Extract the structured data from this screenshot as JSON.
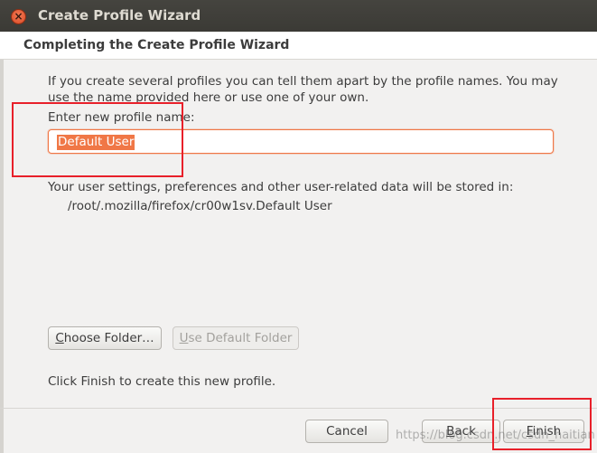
{
  "window": {
    "title": "Create Profile Wizard",
    "close_glyph": "×"
  },
  "page": {
    "heading": "Completing the Create Profile Wizard",
    "description": "If you create several profiles you can tell them apart by the profile names. You may use the name provided here or use one of your own.",
    "name_prompt": "Enter new profile name:",
    "profile_name_value": "Default User",
    "storage_label": "Your user settings, preferences and other user-related data will be stored in:",
    "storage_path": "/root/.mozilla/firefox/cr00w1sv.Default User",
    "choose_folder_label_first": "C",
    "choose_folder_label_rest": "hoose Folder…",
    "use_default_label_first": "U",
    "use_default_label_rest": "se Default Folder",
    "finish_note": "Click Finish to create this new profile."
  },
  "buttons": {
    "cancel": "Cancel",
    "back_first": "B",
    "back_rest": "ack",
    "finish_first": "F",
    "finish_rest": "inish"
  },
  "watermark": "https://blog.csdn.net/csdn_haitian",
  "colors": {
    "accent": "#f07746",
    "annotation_red": "#e8202a",
    "titlebar": "#3b3a35"
  }
}
